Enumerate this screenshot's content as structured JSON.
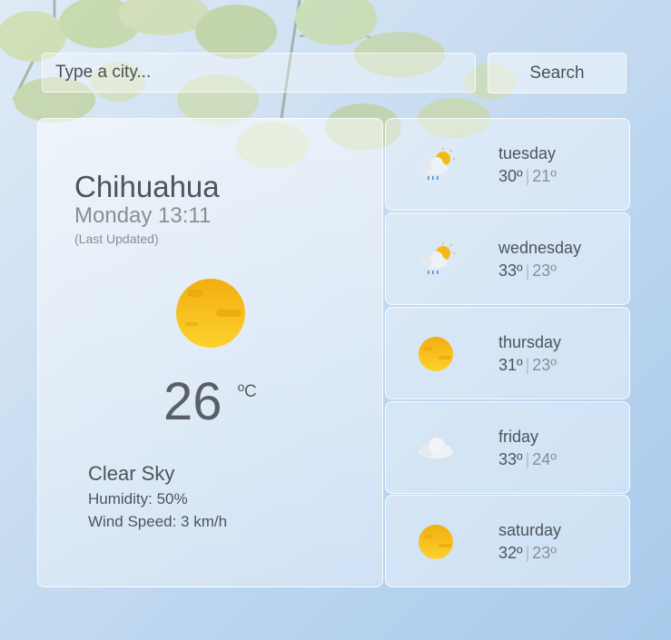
{
  "search": {
    "placeholder": "Type a city...",
    "button_label": "Search"
  },
  "current": {
    "city": "Chihuahua",
    "datetime": "Monday 13:11",
    "updated_note": "(Last Updated)",
    "icon": "sun-icon",
    "temperature": "26",
    "unit": "ºC",
    "description": "Clear Sky",
    "humidity": "Humidity: 50%",
    "wind": "Wind Speed: 3 km/h"
  },
  "forecast": [
    {
      "day": "tuesday",
      "high": "30º",
      "low": "21º",
      "icon": "partly-cloudy-rain-icon"
    },
    {
      "day": "wednesday",
      "high": "33º",
      "low": "23º",
      "icon": "partly-cloudy-rain-icon"
    },
    {
      "day": "thursday",
      "high": "31º",
      "low": "23º",
      "icon": "sun-icon"
    },
    {
      "day": "friday",
      "high": "33º",
      "low": "24º",
      "icon": "cloud-icon"
    },
    {
      "day": "saturday",
      "high": "32º",
      "low": "23º",
      "icon": "sun-icon"
    }
  ],
  "forecast_separator": "|",
  "colors": {
    "sun": "#f5b915",
    "sun_light": "#fccf2a",
    "cloud": "#eef1f5",
    "rain": "#4f8fd6"
  }
}
